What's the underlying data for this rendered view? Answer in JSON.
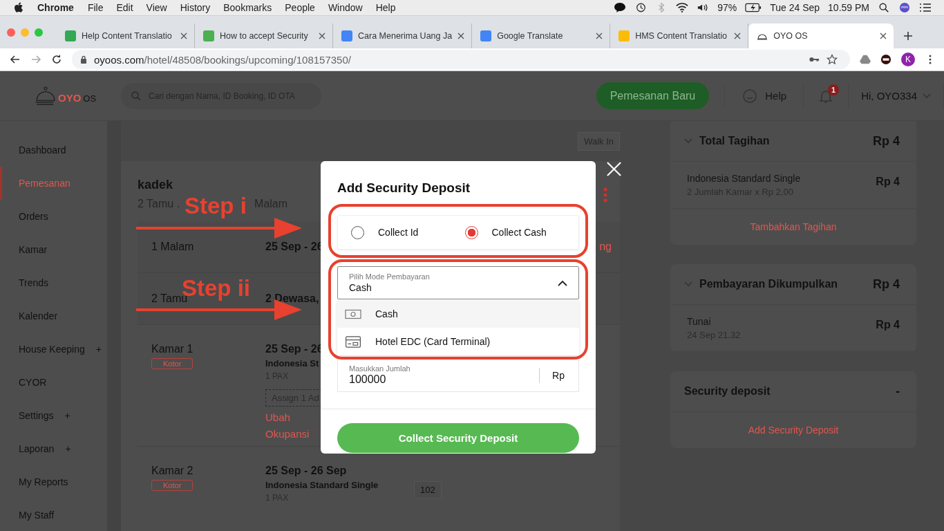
{
  "menu_bar": {
    "app": "Chrome",
    "menus": [
      "File",
      "Edit",
      "View",
      "History",
      "Bookmarks",
      "People",
      "Window",
      "Help"
    ],
    "battery": "97%",
    "date": "Tue 24 Sep",
    "time": "10.59 PM"
  },
  "tabs": [
    {
      "title": "Help Content Translatio",
      "selected": false
    },
    {
      "title": "How to accept Security",
      "selected": false
    },
    {
      "title": "Cara Menerima Uang Ja",
      "selected": false
    },
    {
      "title": "Google Translate",
      "selected": false
    },
    {
      "title": "HMS Content Translatio",
      "selected": false
    },
    {
      "title": "OYO OS",
      "selected": true
    }
  ],
  "address_bar": {
    "domain": "oyoos.com",
    "path": "/hotel/48508/bookings/upcoming/108157350/"
  },
  "profile": {
    "initial": "K"
  },
  "app_header": {
    "logo": "OYO",
    "logo_suffix": "OS",
    "search_placeholder": "Cari dengan Nama, ID Booking, ID OTA",
    "new_booking": "Pemesanan Baru",
    "help": "Help",
    "notifications": "1",
    "user": "Hi, OYO334"
  },
  "sidebar": [
    {
      "label": "Dashboard",
      "selected": false
    },
    {
      "label": "Pemesanan",
      "selected": true
    },
    {
      "label": "Orders",
      "selected": false
    },
    {
      "label": "Kamar",
      "selected": false
    },
    {
      "label": "Trends",
      "selected": false
    },
    {
      "label": "Kalender",
      "selected": false
    },
    {
      "label": "House Keeping",
      "selected": false,
      "plus": "+"
    },
    {
      "label": "CYOR",
      "selected": false
    },
    {
      "label": "Settings",
      "selected": false,
      "plus": "+"
    },
    {
      "label": "Laporan",
      "selected": false,
      "plus": "+"
    },
    {
      "label": "My Reports",
      "selected": false
    },
    {
      "label": "My Staff",
      "selected": false
    }
  ],
  "walk_in": "Walk In",
  "booking": {
    "guest": "kadek",
    "summary_start": "2 Tamu .",
    "summary_end": "Malam",
    "rows": [
      {
        "label": "1 Malam",
        "value": "25 Sep - 26",
        "link": "ng"
      },
      {
        "label": "2 Tamu",
        "value": "2 Dewasa,"
      }
    ],
    "rooms": [
      {
        "name": "Kamar 1",
        "status": "Kotor",
        "dates": "25 Sep - 26",
        "type": "Indonesia St",
        "pax": "1 PAX",
        "assign": "Assign 1 Ad",
        "link": "Ubah Okupansi"
      },
      {
        "name": "Kamar 2",
        "status": "Kotor",
        "dates": "25 Sep - 26 Sep",
        "type": "Indonesia Standard Single",
        "pax": "1 PAX",
        "number": "102"
      }
    ]
  },
  "bill": [
    {
      "title": "Total Tagihan",
      "amount": "Rp 4",
      "collapsible": true,
      "lines": [
        {
          "name": "Indonesia Standard Single",
          "detail": "2 Jumlah Kamar x Rp 2,00",
          "amount": "Rp 4"
        }
      ],
      "action": "Tambahkan Tagihan"
    },
    {
      "title": "Pembayaran Dikumpulkan",
      "amount": "Rp 4",
      "collapsible": true,
      "lines": [
        {
          "name": "Tunai",
          "detail": "24 Sep 21.32",
          "amount": "Rp 4"
        }
      ]
    },
    {
      "title": "Security deposit",
      "amount": "-",
      "collapsible": false,
      "action": "Add Security Deposit"
    }
  ],
  "modal": {
    "title": "Add Security Deposit",
    "options": [
      {
        "label": "Collect Id",
        "selected": false
      },
      {
        "label": "Collect Cash",
        "selected": true
      }
    ],
    "payment_mode": {
      "label": "Pilih Mode Pembayaran",
      "value": "Cash",
      "expanded": true,
      "choices": [
        {
          "kind": "cash",
          "label": "Cash",
          "selected": true
        },
        {
          "kind": "card",
          "label": "Hotel EDC (Card Terminal)",
          "selected": false
        }
      ]
    },
    "amount": {
      "label": "Masukkan Jumlah",
      "value": "100000",
      "unit": "Rp"
    },
    "submit": "Collect Security Deposit"
  },
  "annotations": [
    {
      "label": "Step i"
    },
    {
      "label": "Step ii"
    }
  ]
}
